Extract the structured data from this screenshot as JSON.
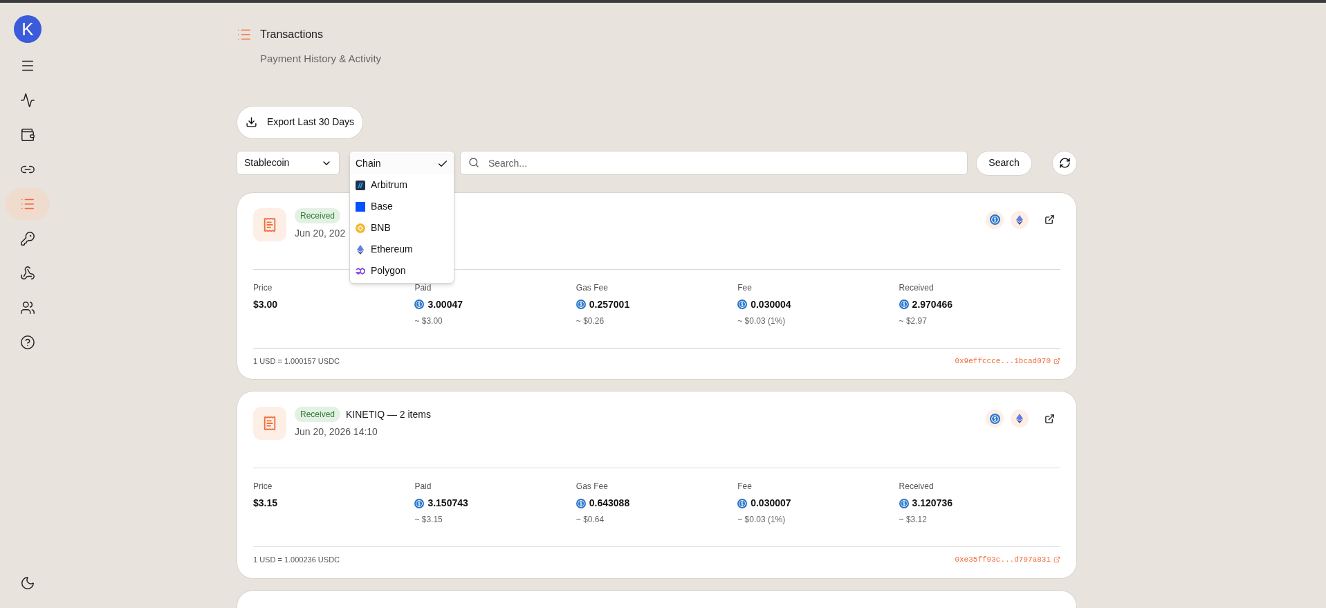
{
  "sidebar": {
    "logo": "K",
    "items": [
      {
        "selected": false
      },
      {
        "selected": false
      },
      {
        "selected": false
      },
      {
        "selected": false
      },
      {
        "selected": true
      },
      {
        "selected": false
      },
      {
        "selected": false
      },
      {
        "selected": false
      },
      {
        "selected": false
      }
    ]
  },
  "header": {
    "title": "Transactions",
    "subtitle": "Payment History & Activity"
  },
  "export_button": "Export Last 30 Days",
  "filters": {
    "stablecoin": "Stablecoin",
    "chain": {
      "options": [
        {
          "label": "Chain",
          "kind": "all",
          "selected": true
        },
        {
          "label": "Arbitrum",
          "kind": "arbitrum",
          "selected": false
        },
        {
          "label": "Base",
          "kind": "base",
          "selected": false
        },
        {
          "label": "BNB",
          "kind": "bnb",
          "selected": false
        },
        {
          "label": "Ethereum",
          "kind": "ethereum",
          "selected": false
        },
        {
          "label": "Polygon",
          "kind": "polygon",
          "selected": false
        }
      ]
    },
    "search": {
      "placeholder": "Search..."
    },
    "search_button": "Search"
  },
  "transactions": [
    {
      "status": "Received",
      "date": "Jun 20, 202",
      "metrics": [
        {
          "label": "Price",
          "value": "$3.00",
          "coin": false
        },
        {
          "label": "Paid",
          "value": "3.00047",
          "sub": "~ $3.00",
          "coin": true
        },
        {
          "label": "Gas Fee",
          "value": "0.257001",
          "sub": "~ $0.26",
          "coin": true
        },
        {
          "label": "Fee",
          "value": "0.030004",
          "sub": "~ $0.03 (1%)",
          "coin": true
        },
        {
          "label": "Received",
          "value": "2.970466",
          "sub": "~ $2.97",
          "coin": true
        }
      ],
      "rate": "1 USD = 1.000157 USDC",
      "hash": "0x9effccce...1bcad070"
    },
    {
      "status": "Received",
      "title": "KINETIQ — 2 items",
      "date": "Jun 20, 2026 14:10",
      "metrics": [
        {
          "label": "Price",
          "value": "$3.15",
          "coin": false
        },
        {
          "label": "Paid",
          "value": "3.150743",
          "sub": "~ $3.15",
          "coin": true
        },
        {
          "label": "Gas Fee",
          "value": "0.643088",
          "sub": "~ $0.64",
          "coin": true
        },
        {
          "label": "Fee",
          "value": "0.030007",
          "sub": "~ $0.03 (1%)",
          "coin": true
        },
        {
          "label": "Received",
          "value": "3.120736",
          "sub": "~ $3.12",
          "coin": true
        }
      ],
      "rate": "1 USD = 1.000236 USDC",
      "hash": "0xe35ff93c...d797a831"
    }
  ]
}
